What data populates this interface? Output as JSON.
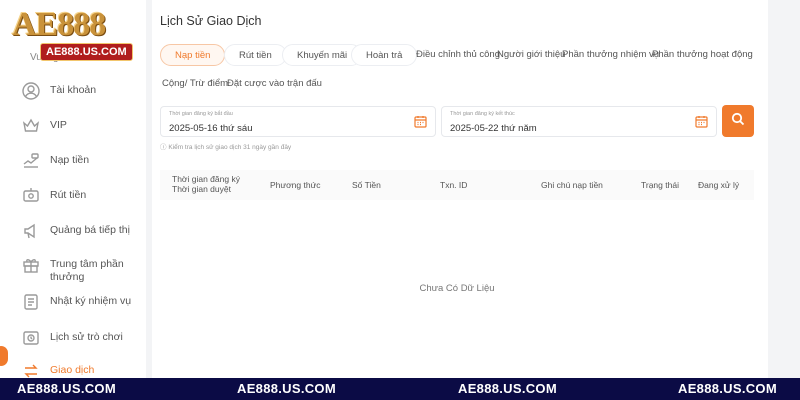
{
  "brand": {
    "logo": "AE888",
    "url": "AE888.US.COM"
  },
  "sidebar": {
    "partial_label": "Vuốt giải",
    "items": [
      {
        "label": "Tài khoản",
        "icon": "user-icon"
      },
      {
        "label": "VIP",
        "icon": "vip-icon"
      },
      {
        "label": "Nạp tiền",
        "icon": "deposit-icon"
      },
      {
        "label": "Rút tiền",
        "icon": "withdraw-icon"
      },
      {
        "label": "Quảng bá tiếp thị",
        "icon": "promo-icon"
      },
      {
        "label": "Trung tâm phần thưởng",
        "icon": "gift-icon"
      },
      {
        "label": "Nhật ký nhiệm vụ",
        "icon": "task-icon"
      },
      {
        "label": "Lịch sử trò chơi",
        "icon": "history-icon"
      },
      {
        "label": "Giao dịch",
        "icon": "transaction-icon"
      }
    ]
  },
  "main": {
    "title": "Lịch Sử Giao Dịch",
    "tabs": [
      "Nạp tiền",
      "Rút tiền",
      "Khuyến mãi",
      "Hoàn trả",
      "Điều chỉnh thủ công",
      "Người giới thiệu",
      "Phần thưởng nhiệm vụ",
      "Phần thưởng hoạt động",
      "Cộng/ Trừ điểm",
      "Đặt cược vào trận đấu"
    ],
    "active_tab": "Nạp tiền",
    "start_date": {
      "label": "Thời gian đăng ký bắt đầu",
      "value": "2025-05-16 thứ sáu"
    },
    "end_date": {
      "label": "Thời gian đăng ký kết thúc",
      "value": "2025-05-22 thứ năm"
    },
    "hint": "Kiểm tra lịch sử giao dịch 31 ngày gần đây",
    "columns": {
      "time_line1": "Thời gian đăng ký",
      "time_line2": "Thời gian duyệt",
      "method": "Phương thức",
      "amount": "Số Tiền",
      "txn": "Txn. ID",
      "note": "Ghi chú nạp tiền",
      "status": "Trạng thái",
      "processing": "Đang xử lý"
    },
    "empty": "Chưa Có Dữ Liệu"
  },
  "footer": [
    "AE888.US.COM",
    "AE888.US.COM",
    "AE888.US.COM",
    "AE888.US.COM"
  ],
  "colors": {
    "accent": "#f07a2c",
    "footer_bg": "#0b0b45",
    "logo_badge": "#b01d1d"
  }
}
